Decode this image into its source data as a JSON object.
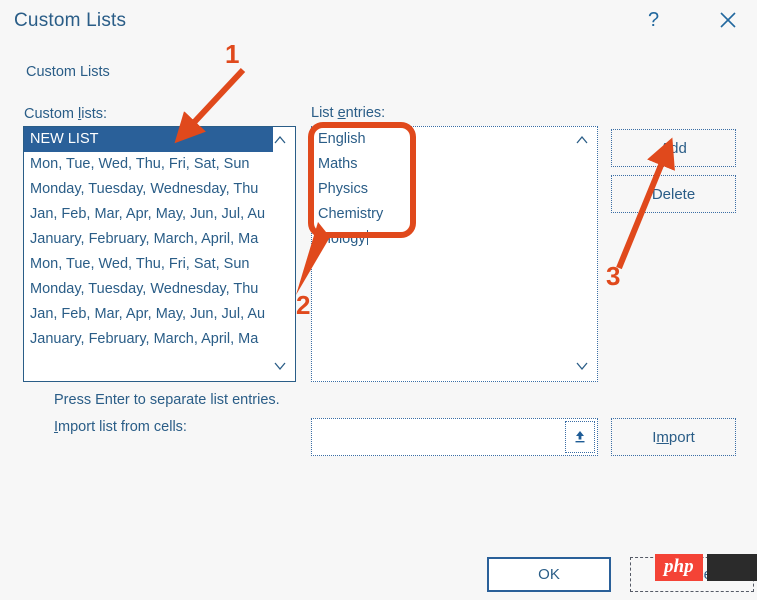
{
  "window": {
    "title": "Custom Lists",
    "help_icon": "question-mark-icon",
    "close_icon": "close-x-icon"
  },
  "section": {
    "heading": "Custom Lists"
  },
  "labels": {
    "custom_lists": "Custom lists:",
    "custom_lists_accel": "l",
    "list_entries": "List entries:",
    "list_entries_accel": "e",
    "hint": "Press Enter to separate list entries.",
    "import_from_cells": "Import list from cells:",
    "import_from_cells_accel": "I"
  },
  "custom_lists": {
    "selected_index": 0,
    "items": [
      "NEW LIST",
      "Mon, Tue, Wed, Thu, Fri, Sat, Sun",
      "Monday, Tuesday, Wednesday, Thu",
      "Jan, Feb, Mar, Apr, May, Jun, Jul, Au",
      "January, February, March, April, Ma",
      "Mon, Tue, Wed, Thu, Fri, Sat, Sun",
      "Monday, Tuesday, Wednesday, Thu",
      "Jan, Feb, Mar, Apr, May, Jun, Jul, Au",
      "January, February, March, April, Ma"
    ]
  },
  "list_entries": {
    "items": [
      "English",
      "Maths",
      "Physics",
      "Chemistry",
      "Biology"
    ],
    "caret_after": "Biology"
  },
  "buttons": {
    "add": "Add",
    "add_accel": "A",
    "delete": "Delete",
    "import": "Import",
    "import_accel": "m",
    "ok": "OK",
    "cancel": "Cancel"
  },
  "import_field": {
    "value": "",
    "placeholder": "",
    "picker_icon": "collapse-dialog-icon"
  },
  "annotations": {
    "marker_1": "1",
    "marker_2": "2",
    "marker_3": "3",
    "color": "#e0491c"
  },
  "watermark": {
    "logo_text": "php"
  },
  "colors": {
    "text": "#2a5d87",
    "selection": "#2a6099",
    "annotation": "#e0491c",
    "background": "#f7f7f7",
    "php_red": "#f44336"
  }
}
